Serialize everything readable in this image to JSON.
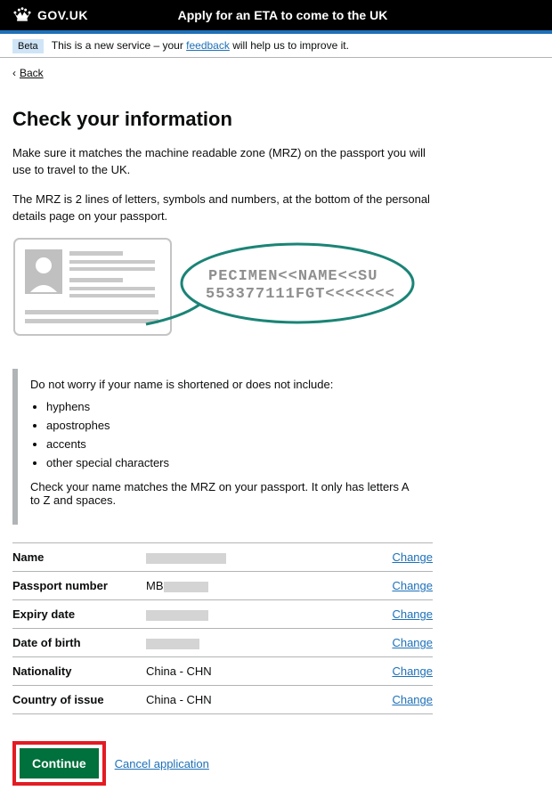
{
  "header": {
    "logo_text": "GOV.UK",
    "service_name": "Apply for an ETA to come to the UK"
  },
  "phase": {
    "tag": "Beta",
    "text_before": "This is a new service – your ",
    "link": "feedback",
    "text_after": " will help us to improve it."
  },
  "back": {
    "label": "Back"
  },
  "title": "Check your information",
  "intro1": "Make sure it matches the machine readable zone (MRZ) on the passport you will use to travel to the UK.",
  "intro2": "The MRZ is 2 lines of letters, symbols and numbers, at the bottom of the personal details page on your passport.",
  "mrz_sample": {
    "line1": "PECIMEN<<NAME<<SU",
    "line2": "553377111FGT<<<<<<<"
  },
  "inset": {
    "lead": "Do not worry if your name is shortened or does not include:",
    "items": [
      "hyphens",
      "apostrophes",
      "accents",
      "other special characters"
    ],
    "tail": "Check your name matches the MRZ on your passport. It only has letters A to Z and spaces."
  },
  "rows": [
    {
      "key": "Name",
      "value": "",
      "redacted_width": 90,
      "action": "Change"
    },
    {
      "key": "Passport number",
      "value": "MB",
      "redacted_width": 50,
      "action": "Change"
    },
    {
      "key": "Expiry date",
      "value": "",
      "redacted_width": 70,
      "action": "Change"
    },
    {
      "key": "Date of birth",
      "value": "",
      "redacted_width": 60,
      "action": "Change"
    },
    {
      "key": "Nationality",
      "value": "China - CHN",
      "redacted_width": 0,
      "action": "Change"
    },
    {
      "key": "Country of issue",
      "value": "China - CHN",
      "redacted_width": 0,
      "action": "Change"
    }
  ],
  "actions": {
    "continue": "Continue",
    "cancel": "Cancel application"
  }
}
